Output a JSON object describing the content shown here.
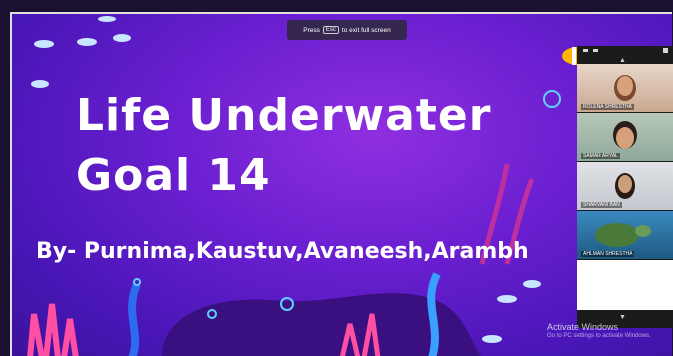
{
  "slide": {
    "title_line1": "Life Underwater",
    "title_line2": "Goal 14",
    "authors": "By-  Purnima,Kaustuv,Avaneesh,Arambh"
  },
  "fullscreen_hint": {
    "press": "Press",
    "key": "Esc",
    "suffix": "to exit full screen"
  },
  "participants": [
    {
      "name": "ROLENA SHRESTHA"
    },
    {
      "name": "SAMAR ARYAL"
    },
    {
      "name": "SHARVANI BAN"
    },
    {
      "name": "AHLMAN SHRESTHA"
    }
  ],
  "windows_watermark": {
    "title": "Activate Windows",
    "subtitle": "Go to PC settings to activate Windows."
  },
  "colors": {
    "slide_bg": "#6a1fd0",
    "panel_bg": "#1b1b1b",
    "accent_pink": "#ff4fa3"
  },
  "icons": [
    "fish-icon",
    "chevron-up-icon",
    "chevron-down-icon",
    "minimize-icon",
    "maximize-icon"
  ]
}
